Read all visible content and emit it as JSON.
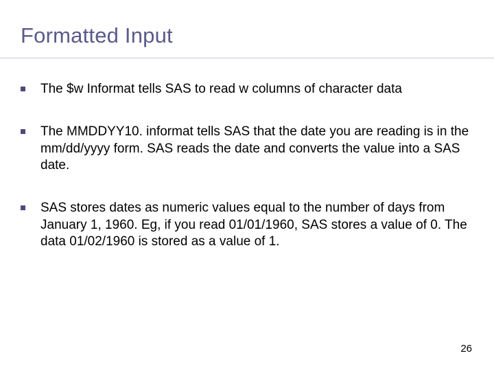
{
  "slide": {
    "title": "Formatted Input",
    "page_number": "26",
    "bullets": [
      {
        "text": "The $w  Informat tells SAS to read w columns of character data"
      },
      {
        "text": "The MMDDYY10. informat tells SAS that the date you are reading is in the mm/dd/yyyy form. SAS reads the date and converts the value into a SAS date."
      },
      {
        "text": "SAS stores dates as numeric values equal to the number of days from January 1, 1960. Eg, if you read 01/01/1960, SAS stores a value of 0. The data 01/02/1960 is stored as a value of 1."
      }
    ]
  }
}
